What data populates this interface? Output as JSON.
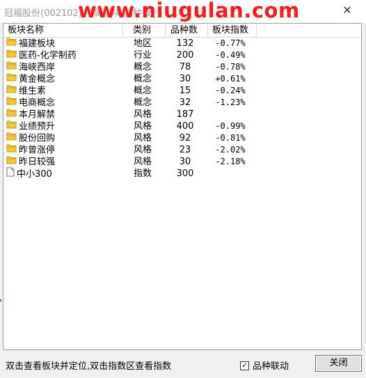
{
  "window": {
    "title": "冠福股份(002102) 所属板块 品种数",
    "watermark": "www.niugulan.com",
    "close_symbol": "✕"
  },
  "columns": {
    "name": "板块名称",
    "type": "类别",
    "count": "品种数",
    "index": "板块指数"
  },
  "rows": [
    {
      "name": "福建板块",
      "type": "地区",
      "count": "132",
      "index": "-0.77%",
      "icon": "folder-icon"
    },
    {
      "name": "医药-化学制药",
      "type": "行业",
      "count": "200",
      "index": "-0.49%",
      "icon": "folder-icon"
    },
    {
      "name": "海峡西岸",
      "type": "概念",
      "count": "78",
      "index": "-0.78%",
      "icon": "folder-icon"
    },
    {
      "name": "黄金概念",
      "type": "概念",
      "count": "30",
      "index": "+0.61%",
      "icon": "folder-icon"
    },
    {
      "name": "维生素",
      "type": "概念",
      "count": "15",
      "index": "-0.24%",
      "icon": "folder-icon"
    },
    {
      "name": "电商概念",
      "type": "概念",
      "count": "32",
      "index": "-1.23%",
      "icon": "folder-icon"
    },
    {
      "name": "本月解禁",
      "type": "风格",
      "count": "187",
      "index": "",
      "icon": "folder-icon"
    },
    {
      "name": "业绩预升",
      "type": "风格",
      "count": "400",
      "index": "-0.99%",
      "icon": "folder-icon"
    },
    {
      "name": "股份回购",
      "type": "风格",
      "count": "92",
      "index": "-0.81%",
      "icon": "folder-icon"
    },
    {
      "name": "昨曾涨停",
      "type": "风格",
      "count": "23",
      "index": "-2.02%",
      "icon": "folder-icon"
    },
    {
      "name": "昨日较强",
      "type": "风格",
      "count": "30",
      "index": "-2.18%",
      "icon": "folder-icon"
    },
    {
      "name": "中小300",
      "type": "指数",
      "count": "300",
      "index": "",
      "icon": "document-icon"
    }
  ],
  "status": {
    "hint": "双击查看板块并定位,双击指数区查看指数",
    "linkage_label": "品种联动",
    "linkage_checked": true,
    "close_button": "关闭"
  },
  "colors": {
    "folder": "#f3c73a",
    "folder_edge": "#c79a14",
    "watermark": "#ff1a1a"
  }
}
